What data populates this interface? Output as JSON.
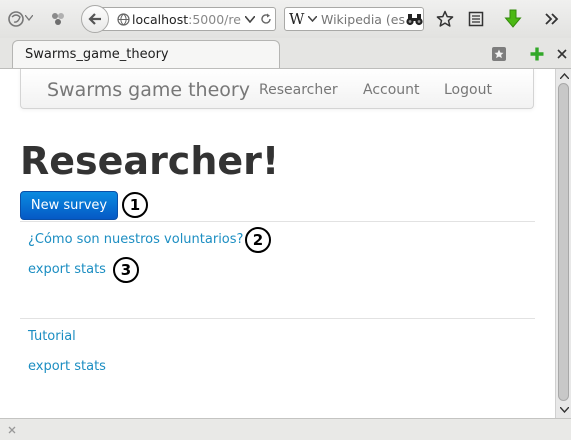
{
  "browser": {
    "url_host": "localhost",
    "url_rest": ":5000/re",
    "search_placeholder": "Wikipedia (es",
    "search_engine_label": "W"
  },
  "tab": {
    "title": "Swarms_game_theory"
  },
  "navbar": {
    "brand": "Swarms game theory",
    "links": [
      {
        "label": "Researcher"
      },
      {
        "label": "Account"
      },
      {
        "label": "Logout"
      }
    ]
  },
  "main": {
    "heading": "Researcher!",
    "new_survey_label": "New survey",
    "links": [
      {
        "label": "¿Cómo son nuestros voluntarios?"
      },
      {
        "label": "export stats"
      }
    ],
    "footer_links": [
      {
        "label": "Tutorial"
      },
      {
        "label": "export stats"
      }
    ]
  },
  "callouts": [
    "1",
    "2",
    "3"
  ],
  "colors": {
    "link": "#1c8ec2",
    "primary_button": "#0566d2",
    "heading": "#333333",
    "nav_text": "#777777",
    "download_arrow": "#4cb814",
    "new_tab_plus": "#32a829"
  }
}
